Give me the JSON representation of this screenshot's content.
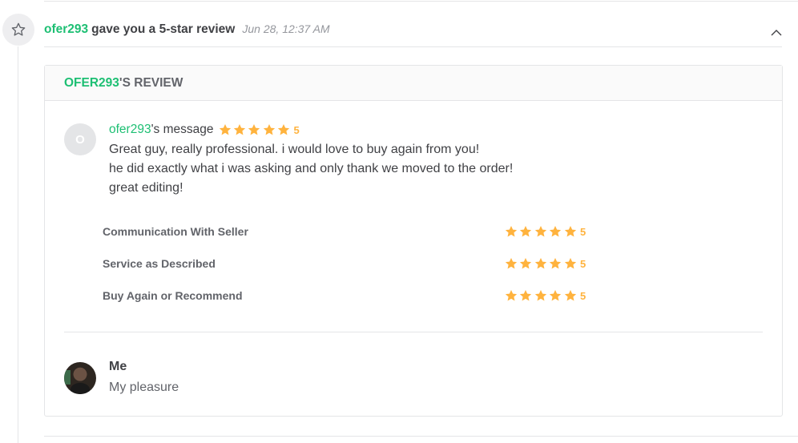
{
  "event": {
    "username": "ofer293",
    "action_text": "gave you a 5-star review",
    "timestamp": "Jun 28, 12:37 AM",
    "icon": "star-outline-icon",
    "collapse_icon": "chevron-up-icon"
  },
  "review": {
    "header_username": "OFER293",
    "header_suffix": "'S REVIEW",
    "reviewer_initial": "O",
    "reviewer_name": "ofer293",
    "message_suffix": "'s message",
    "overall_rating": "5",
    "message_lines": [
      "Great guy, really professional. i would love to buy again from you!",
      "he did exactly what i was asking and only thank we moved to the order!",
      "great editing!"
    ],
    "ratings": [
      {
        "label": "Communication With Seller",
        "value": "5"
      },
      {
        "label": "Service as Described",
        "value": "5"
      },
      {
        "label": "Buy Again or Recommend",
        "value": "5"
      }
    ]
  },
  "reply": {
    "name": "Me",
    "text": "My pleasure"
  },
  "colors": {
    "accent": "#1dbf73",
    "star": "#ffb33e",
    "text": "#404145",
    "muted": "#95979d",
    "border": "#e4e5e7"
  }
}
